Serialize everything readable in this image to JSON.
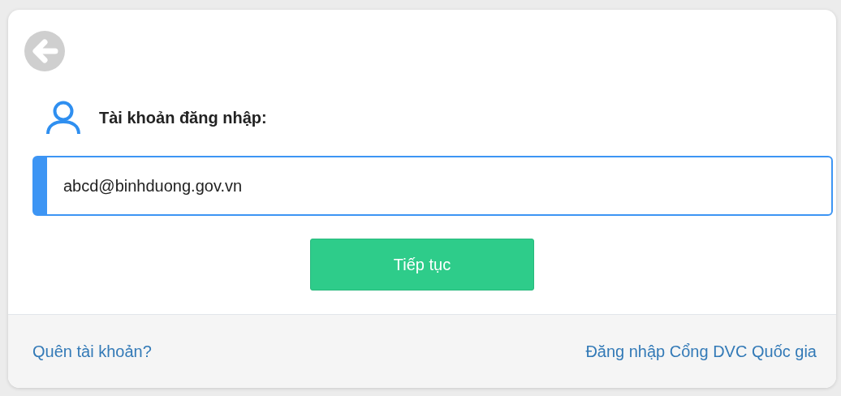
{
  "account_label": "Tài khoản đăng nhập:",
  "account_field": {
    "value": "abcd@binhduong.gov.vn"
  },
  "continue_button": "Tiếp tục",
  "footer_links": [
    {
      "label": "Quên tài khoản?"
    },
    {
      "label": "Đăng nhập Cổng DVC Quốc gia"
    }
  ]
}
